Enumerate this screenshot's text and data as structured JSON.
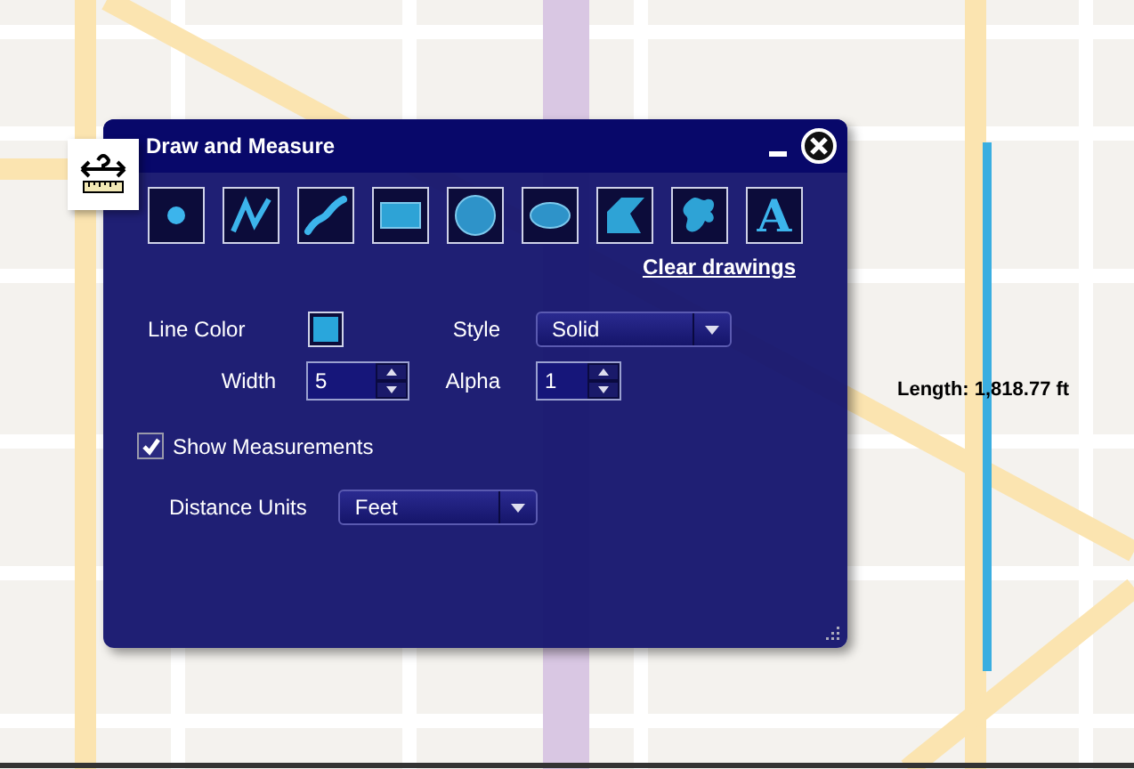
{
  "map": {
    "measurement": {
      "label": "Length: 1,818.77 ft"
    }
  },
  "dialog": {
    "title": "Draw and Measure",
    "tools": [
      {
        "kind": "point"
      },
      {
        "kind": "polyline"
      },
      {
        "kind": "freehand-line"
      },
      {
        "kind": "rectangle"
      },
      {
        "kind": "circle"
      },
      {
        "kind": "ellipse"
      },
      {
        "kind": "polygon"
      },
      {
        "kind": "freehand-polygon"
      },
      {
        "kind": "text",
        "glyph": "A"
      }
    ],
    "clear_link": "Clear drawings",
    "line_color": {
      "label": "Line Color",
      "color": "#29a6dc"
    },
    "style": {
      "label": "Style",
      "value": "Solid"
    },
    "width": {
      "label": "Width",
      "value": "5"
    },
    "alpha": {
      "label": "Alpha",
      "value": "1"
    },
    "show_measurements": {
      "label": "Show Measurements",
      "checked": true
    },
    "distance_units": {
      "label": "Distance Units",
      "value": "Feet"
    }
  }
}
